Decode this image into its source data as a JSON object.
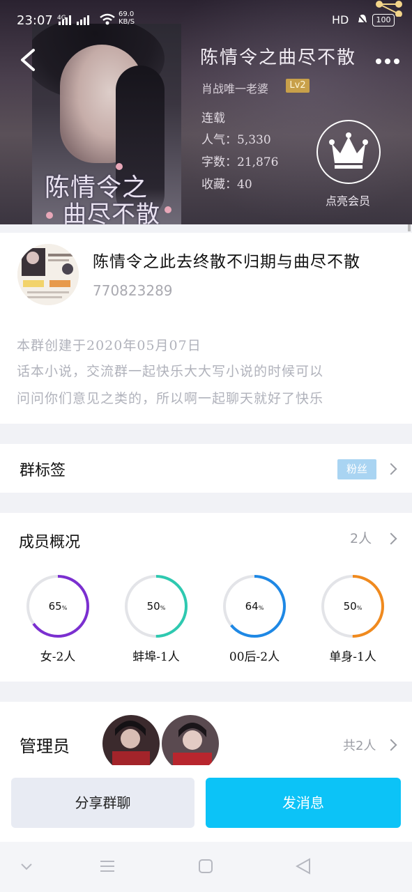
{
  "status_bar": {
    "time": "23:07",
    "network": "4G",
    "speed_value": "69.0",
    "speed_unit": "KB/S",
    "hd": "HD",
    "battery": "100"
  },
  "header": {
    "novel_title": "陈情令之曲尽不散",
    "author": "肖战唯一老婆",
    "level": "Lv2",
    "status": "连载",
    "popularity": "人气：5,330",
    "word_count": "字数：21,876",
    "favorites": "收藏：40",
    "vip_label": "点亮会员",
    "cover_title_line1": "陈情令之",
    "cover_title_line2": "曲尽不散"
  },
  "group": {
    "name": "陈情令之此去终散不归期与曲尽不散",
    "id": "770823289",
    "intro_line1": "本群创建于2020年05月07日",
    "intro_line2": "话本小说，交流群一起快乐大大写小说的时候可以",
    "intro_line3": "问问你们意见之类的，所以啊一起聊天就好了快乐"
  },
  "tags": {
    "title": "群标签",
    "chip": "粉丝"
  },
  "members": {
    "title": "成员概况",
    "count": "2人",
    "stats": [
      {
        "percent": "65",
        "label": "女-2人",
        "value": 0.65,
        "color": "#7b2fd0"
      },
      {
        "percent": "50",
        "label": "蚌埠-1人",
        "value": 0.5,
        "color": "#2ec9b0"
      },
      {
        "percent": "64",
        "label": "00后-2人",
        "value": 0.64,
        "color": "#1e88e5"
      },
      {
        "percent": "50",
        "label": "单身-1人",
        "value": 0.5,
        "color": "#f08a1e"
      }
    ]
  },
  "admins": {
    "title": "管理员",
    "total": "共2人"
  },
  "actions": {
    "share": "分享群聊",
    "message": "发消息"
  },
  "colors": {
    "accent": "#0cc3f7",
    "tag_chip": "#a9d4f2",
    "level_badge": "#c8a04a"
  }
}
